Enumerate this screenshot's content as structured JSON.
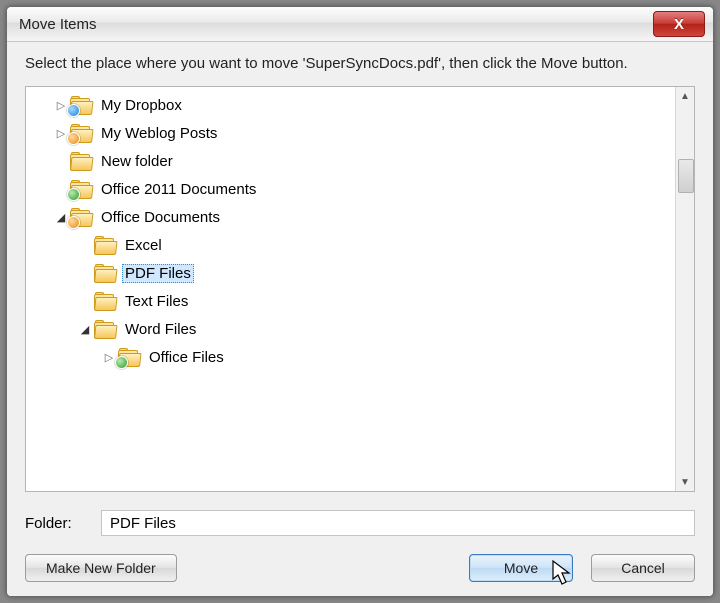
{
  "title": "Move Items",
  "instruction": "Select the place where you want to move 'SuperSyncDocs.pdf', then click the Move button.",
  "tree": {
    "items": [
      {
        "indent": 0,
        "expander": "closed",
        "badge": "blue",
        "label": "My Dropbox",
        "selected": false
      },
      {
        "indent": 0,
        "expander": "closed",
        "badge": "orange",
        "label": "My Weblog Posts",
        "selected": false
      },
      {
        "indent": 0,
        "expander": "none",
        "badge": "none",
        "label": "New folder",
        "selected": false
      },
      {
        "indent": 0,
        "expander": "none",
        "badge": "green",
        "label": "Office 2011 Documents",
        "selected": false
      },
      {
        "indent": 0,
        "expander": "open",
        "badge": "orange",
        "label": "Office Documents",
        "selected": false
      },
      {
        "indent": 1,
        "expander": "none",
        "badge": "none",
        "label": "Excel",
        "selected": false
      },
      {
        "indent": 1,
        "expander": "none",
        "badge": "none",
        "label": "PDF Files",
        "selected": true
      },
      {
        "indent": 1,
        "expander": "none",
        "badge": "none",
        "label": "Text Files",
        "selected": false
      },
      {
        "indent": 1,
        "expander": "open",
        "badge": "none",
        "label": "Word Files",
        "selected": false
      },
      {
        "indent": 2,
        "expander": "closed",
        "badge": "green",
        "label": "Office Files",
        "selected": false
      }
    ]
  },
  "folder_label": "Folder:",
  "folder_value": "PDF Files",
  "buttons": {
    "make_new": "Make New Folder",
    "move": "Move",
    "cancel": "Cancel"
  },
  "close_glyph": "X"
}
